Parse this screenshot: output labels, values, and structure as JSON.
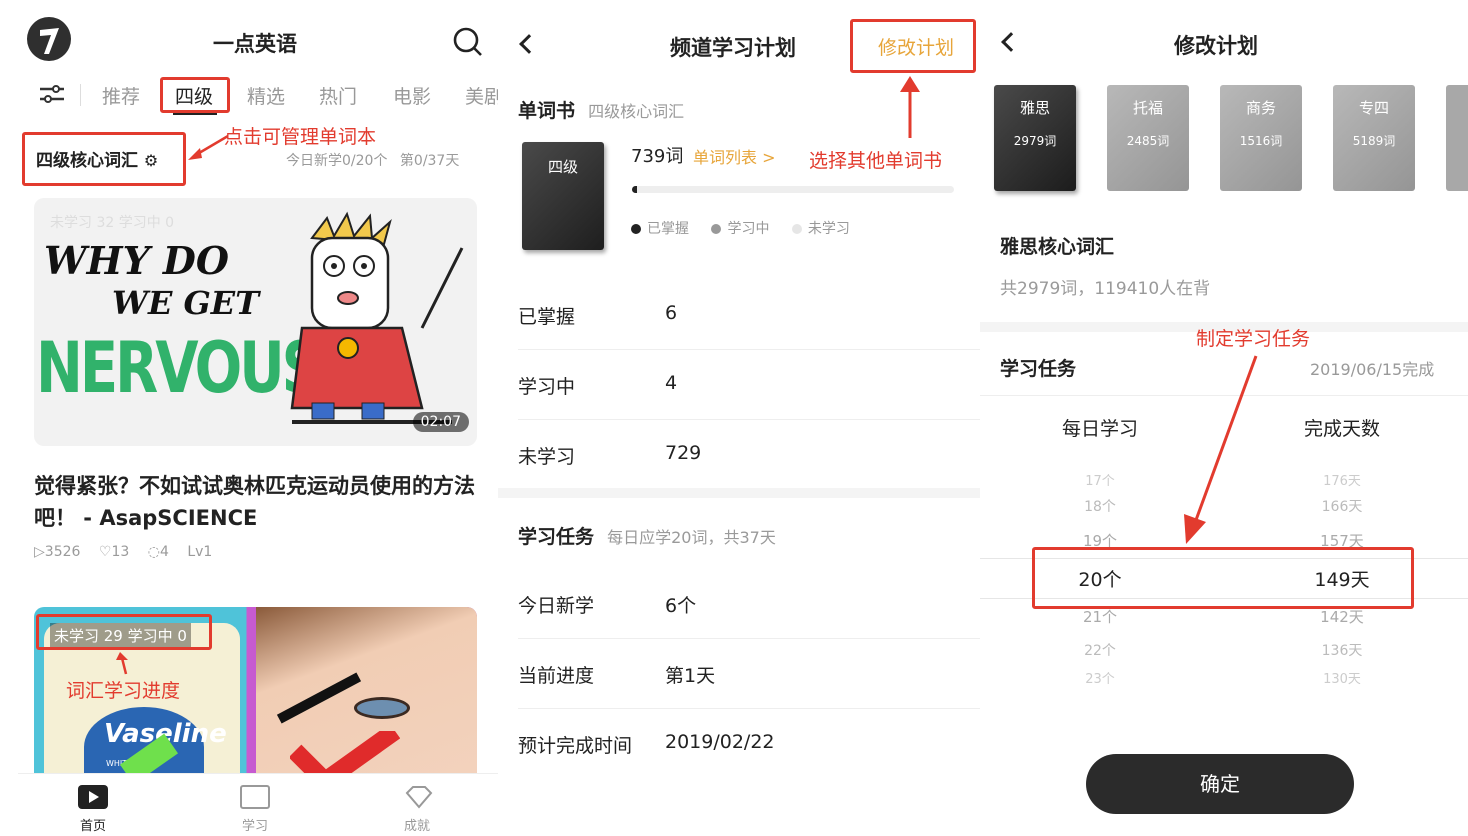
{
  "screen1": {
    "app_title": "一点英语",
    "tabs": [
      "推荐",
      "四级",
      "精选",
      "热门",
      "电影",
      "美剧"
    ],
    "active_tab": "四级",
    "wordbook_title": "四级核心词汇",
    "today_progress": "今日新学0/20个",
    "day_progress": "第0/37天",
    "annotation_manage": "点击可管理单词本",
    "video1": {
      "status": "未学习 32  学习中 0",
      "art_line1": "WHY DO",
      "art_line2": "WE GET",
      "art_line3": "NERVOUS?",
      "duration": "02:07",
      "title": "觉得紧张？不如试试奥林匹克运动员使用的方法吧！ - AsapSCIENCE",
      "plays": "3526",
      "likes": "13",
      "comments": "4",
      "level": "Lv1"
    },
    "video2": {
      "status": "未学习 29  学习中 0",
      "brand": "Vaseline",
      "brand_small": "WHITE PE"
    },
    "annotation_progress": "词汇学习进度",
    "nav": [
      "首页",
      "学习",
      "成就"
    ]
  },
  "screen2": {
    "title": "频道学习计划",
    "edit_button": "修改计划",
    "annotation_select": "选择其他单词书",
    "wordbook_label": "单词书",
    "wordbook_name": "四级核心词汇",
    "book_cover": "四级",
    "word_count": "739词",
    "word_list_link": "单词列表 >",
    "legend": [
      "已掌握",
      "学习中",
      "未学习"
    ],
    "progress_fraction": 0.014,
    "stats": [
      {
        "k": "已掌握",
        "v": "6"
      },
      {
        "k": "学习中",
        "v": "4"
      },
      {
        "k": "未学习",
        "v": "729"
      }
    ],
    "task_label": "学习任务",
    "task_desc": "每日应学20词，共37天",
    "tasks": [
      {
        "k": "今日新学",
        "v": "6个"
      },
      {
        "k": "当前进度",
        "v": "第1天"
      },
      {
        "k": "预计完成时间",
        "v": "2019/02/22"
      }
    ]
  },
  "screen3": {
    "title": "修改计划",
    "books": [
      {
        "name": "雅思",
        "count": "2979词"
      },
      {
        "name": "托福",
        "count": "2485词"
      },
      {
        "name": "商务",
        "count": "1516词"
      },
      {
        "name": "专四",
        "count": "5189词"
      }
    ],
    "selected_name": "雅思核心词汇",
    "selected_info": "共2979词，119410人在背",
    "task_label": "学习任务",
    "finish_date": "2019/06/15完成",
    "annotation_task": "制定学习任务",
    "col_daily": "每日学习",
    "col_days": "完成天数",
    "daily_options_above": [
      "17个",
      "18个",
      "19个"
    ],
    "days_options_above": [
      "176天",
      "166天",
      "157天"
    ],
    "daily_selected": "20个",
    "days_selected": "149天",
    "daily_options_below": [
      "21个",
      "22个",
      "23个"
    ],
    "days_options_below": [
      "142天",
      "136天",
      "130天"
    ],
    "confirm": "确定"
  },
  "colors": {
    "accent": "#e7a53a",
    "annotation": "#e23b2e",
    "dark": "#2b2b2b"
  }
}
